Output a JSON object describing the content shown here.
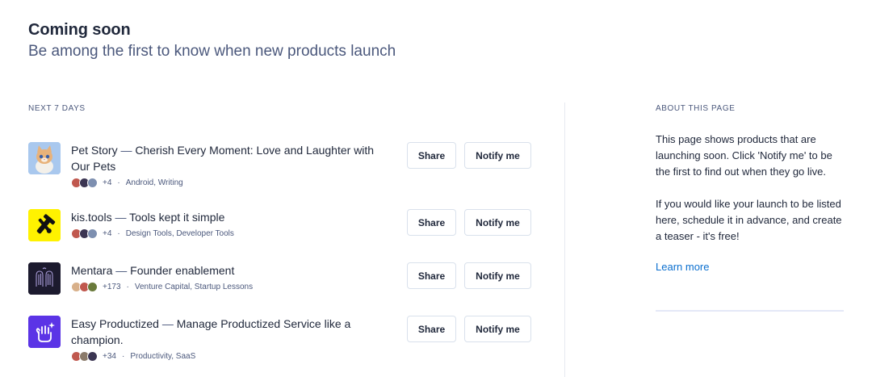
{
  "header": {
    "title": "Coming soon",
    "subtitle": "Be among the first to know when new products launch"
  },
  "upcoming": {
    "section_label": "NEXT 7 DAYS",
    "share_label": "Share",
    "notify_label": "Notify me",
    "products": [
      {
        "name": "Pet Story",
        "separator": " — ",
        "tagline": "Cherish Every Moment: Love and Laughter with Our Pets",
        "follower_count": "+4",
        "dot": "·",
        "tags": "Android, Writing",
        "thumb_icon": "cat-icon",
        "thumb_color": "#8fb7e8"
      },
      {
        "name": "kis.tools",
        "separator": " — ",
        "tagline": "Tools kept it simple",
        "follower_count": "+4",
        "dot": "·",
        "tags": "Design Tools, Developer Tools",
        "thumb_icon": "tools-icon",
        "thumb_color": "#fff200"
      },
      {
        "name": "Mentara",
        "separator": " — ",
        "tagline": "Founder enablement",
        "follower_count": "+173",
        "dot": "·",
        "tags": "Venture Capital, Startup Lessons",
        "thumb_icon": "hands-icon",
        "thumb_color": "#1c1a2e"
      },
      {
        "name": "Easy Productized",
        "separator": " — ",
        "tagline": "Manage Productized Service like a champion.",
        "follower_count": "+34",
        "dot": "·",
        "tags": "Productivity, SaaS",
        "thumb_icon": "sparkle-hand-icon",
        "thumb_color": "#5b34e6"
      }
    ]
  },
  "about": {
    "section_label": "ABOUT THIS PAGE",
    "paragraph_1": "This page shows products that are launching soon. Click 'Notify me' to be the first to find out when they go live.",
    "paragraph_2": "If you would like your launch to be listed here, schedule it in advance, and create a teaser - it's free!",
    "learn_more": "Learn more",
    "link_color": "#0b6fcf"
  }
}
